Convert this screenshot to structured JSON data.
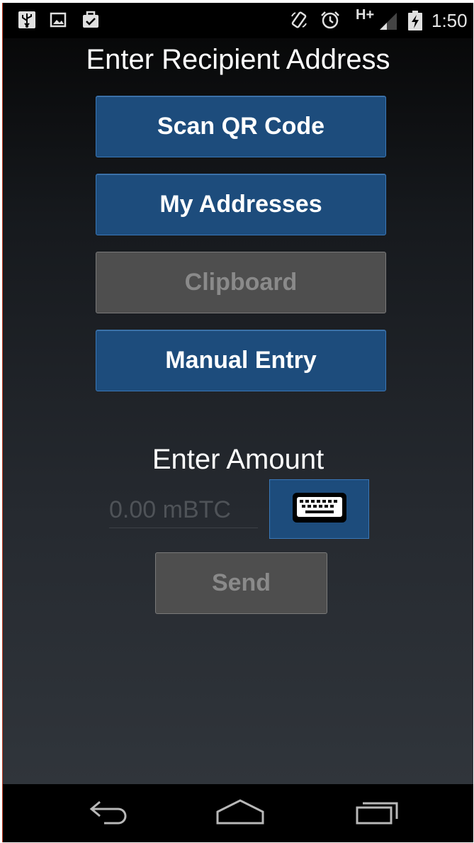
{
  "status_bar": {
    "network": "H+",
    "time": "1:50",
    "icons": [
      "usb-icon",
      "image-icon",
      "briefcase-check-icon",
      "rotation-icon",
      "alarm-icon",
      "signal-icon",
      "battery-charging-icon"
    ]
  },
  "address_section": {
    "title": "Enter Recipient Address",
    "buttons": {
      "scan_qr": "Scan QR Code",
      "my_addresses": "My Addresses",
      "clipboard": "Clipboard",
      "manual_entry": "Manual Entry"
    }
  },
  "amount_section": {
    "title": "Enter Amount",
    "amount_placeholder": "0.00 mBTC",
    "keyboard_icon": "keyboard-icon",
    "send_label": "Send"
  },
  "nav_bar": {
    "icons": [
      "back-icon",
      "home-icon",
      "recents-icon"
    ]
  },
  "colors": {
    "button_blue": "#1d4c7c",
    "button_blue_border": "#3a78b8",
    "button_disabled": "#4e4e4e",
    "disabled_text": "#8a8a8a"
  }
}
